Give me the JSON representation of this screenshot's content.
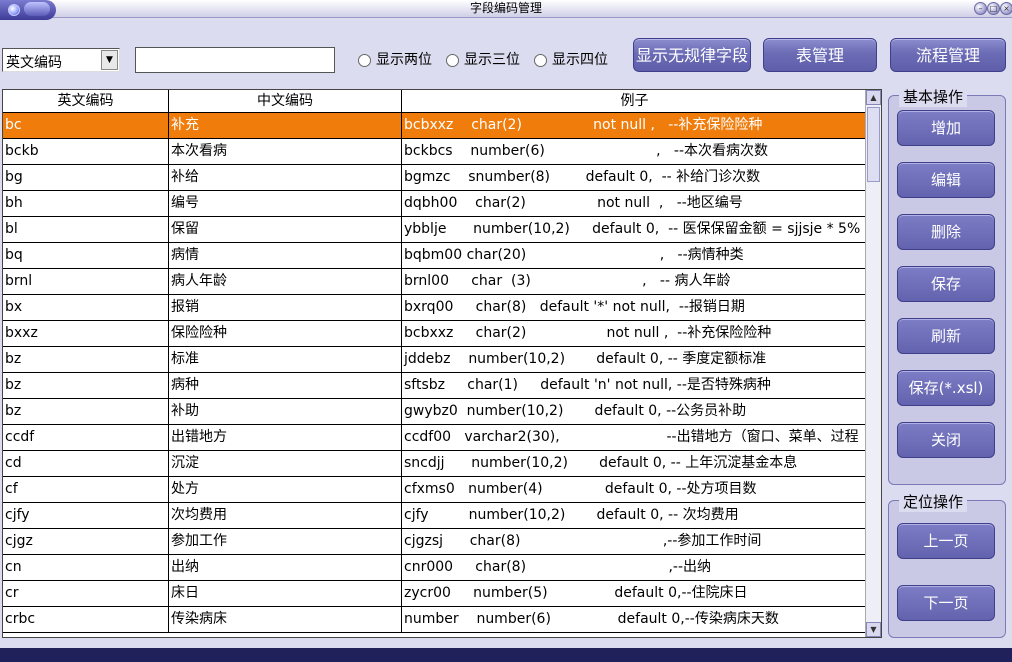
{
  "window": {
    "title": "字段编码管理",
    "controls": [
      "minimize",
      "restore",
      "close"
    ]
  },
  "toolbar": {
    "combo_value": "英文编码",
    "search_value": "",
    "radio_two": "显示两位",
    "radio_three": "显示三位",
    "radio_four": "显示四位",
    "btn_irregular": "显示无规律字段",
    "btn_table": "表管理",
    "btn_flow": "流程管理"
  },
  "grid": {
    "headers": [
      "英文编码",
      "中文编码",
      "例子"
    ],
    "rows": [
      {
        "en": "bc",
        "cn": "补充",
        "ex": "bcbxxz    char(2)                not null ,   --补充保险险种",
        "selected": true
      },
      {
        "en": "bckb",
        "cn": "本次看病",
        "ex": "bckbcs    number(6)                         ,   --本次看病次数"
      },
      {
        "en": "bg",
        "cn": "补给",
        "ex": "bgmzc    snumber(8)        default 0,  -- 补给门诊次数"
      },
      {
        "en": "bh",
        "cn": "编号",
        "ex": "dqbh00    char(2)                not null  ,   --地区编号"
      },
      {
        "en": "bl",
        "cn": "保留",
        "ex": "ybblje      number(10,2)     default 0,  -- 医保保留金额 = sjjsje * 5%"
      },
      {
        "en": "bq",
        "cn": "病情",
        "ex": "bqbm00 char(20)                              ,   --病情种类"
      },
      {
        "en": "brnl",
        "cn": "病人年龄",
        "ex": "brnl00     char  (3)                         ,   -- 病人年龄"
      },
      {
        "en": "bx",
        "cn": "报销",
        "ex": "bxrq00     char(8)   default '*' not null,  --报销日期"
      },
      {
        "en": "bxxz",
        "cn": "保险险种",
        "ex": "bcbxxz     char(2)                  not null ,  --补充保险险种"
      },
      {
        "en": "bz",
        "cn": "标准",
        "ex": "jddebz    number(10,2)       default 0, -- 季度定额标准"
      },
      {
        "en": "bz",
        "cn": "病种",
        "ex": "sftsbz     char(1)     default 'n' not null, --是否特殊病种"
      },
      {
        "en": "bz",
        "cn": "补助",
        "ex": "gwybz0  number(10,2)       default 0, --公务员补助"
      },
      {
        "en": "ccdf",
        "cn": "出错地方",
        "ex": "ccdf00   varchar2(30),                        --出错地方（窗口、菜单、过程"
      },
      {
        "en": "cd",
        "cn": "沉淀",
        "ex": "sncdjj      number(10,2)       default 0, -- 上年沉淀基金本息"
      },
      {
        "en": "cf",
        "cn": "处方",
        "ex": "cfxms0   number(4)              default 0, --处方项目数"
      },
      {
        "en": "cjfy",
        "cn": "次均费用",
        "ex": "cjfy         number(10,2)       default 0, -- 次均费用"
      },
      {
        "en": "cjgz",
        "cn": "参加工作",
        "ex": "cjgzsj      char(8)                                ,--参加工作时间"
      },
      {
        "en": "cn",
        "cn": "出纳",
        "ex": "cnr000     char(8)                                ,--出纳"
      },
      {
        "en": "cr",
        "cn": "床日",
        "ex": "zycr00     number(5)               default 0,--住院床日"
      },
      {
        "en": "crbc",
        "cn": "传染病床",
        "ex": "number    number(6)               default 0,--传染病床天数"
      }
    ]
  },
  "panel_basic": {
    "title": "基本操作",
    "buttons": [
      "增加",
      "编辑",
      "删除",
      "保存",
      "刷新",
      "保存(*.xsl)",
      "关闭"
    ]
  },
  "panel_locate": {
    "title": "定位操作",
    "buttons": [
      "上一页",
      "下一页"
    ]
  },
  "colors": {
    "accent": "#6b6bb6",
    "selected_row": "#f07c0c",
    "background": "#dcdcf0"
  }
}
